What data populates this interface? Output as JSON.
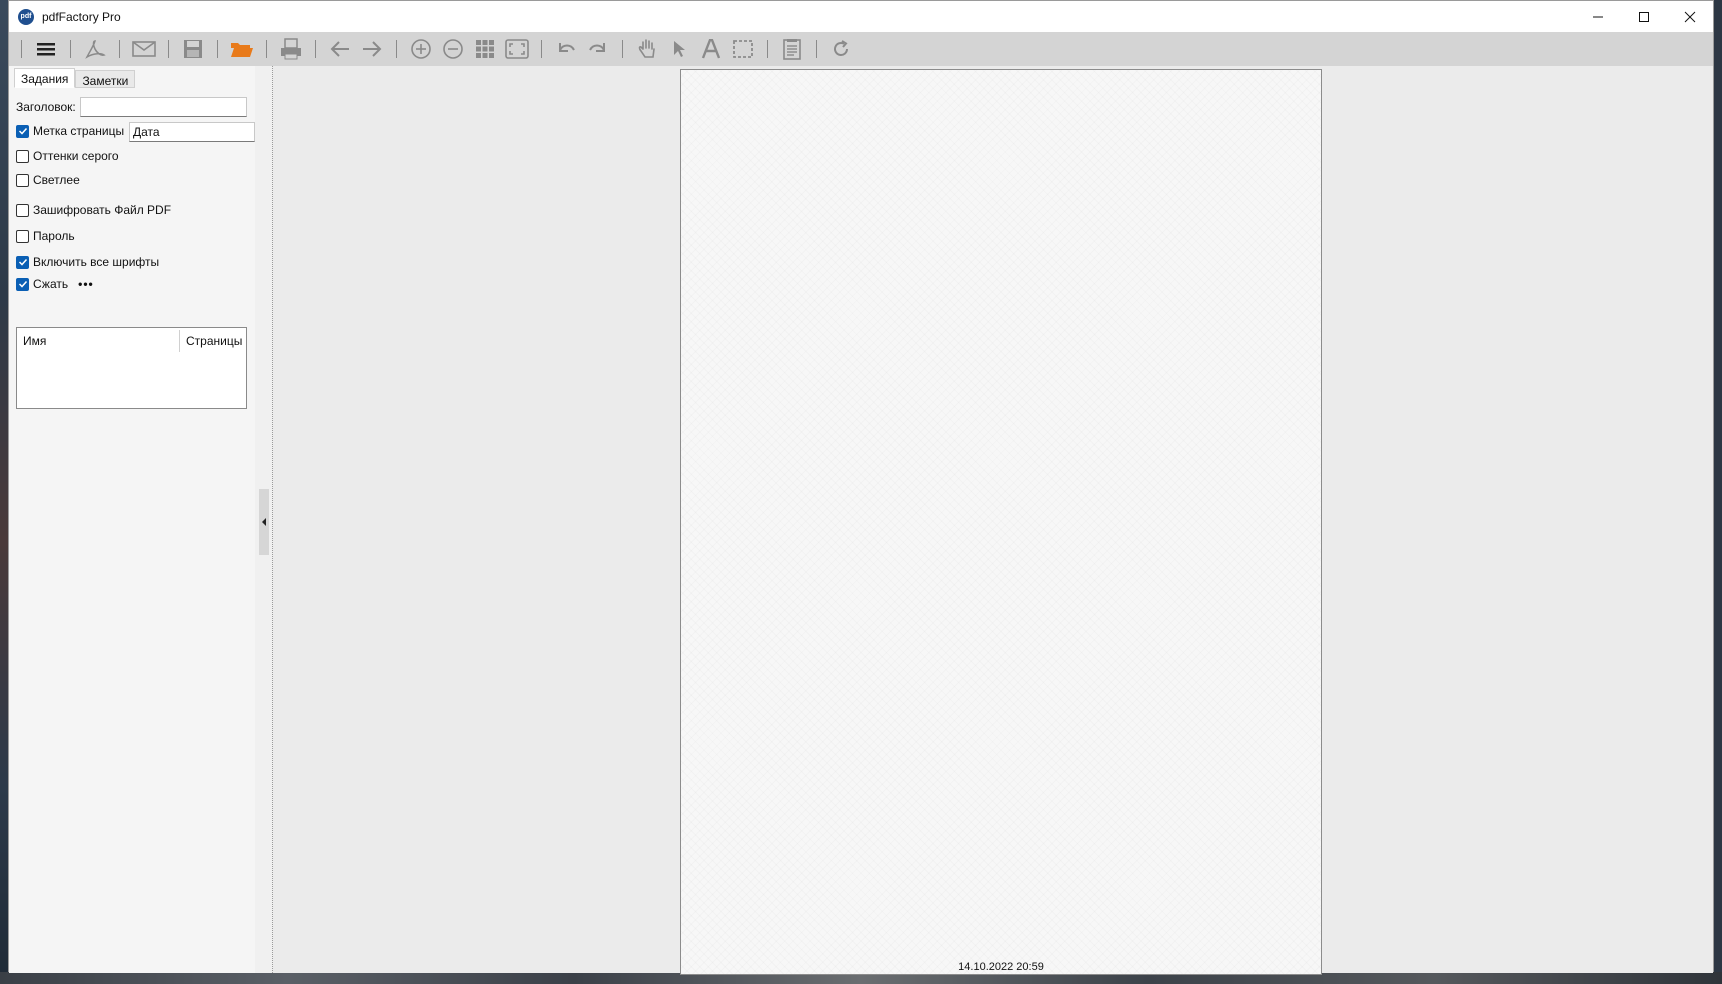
{
  "window": {
    "title": "pdfFactory Pro",
    "app_icon_text": "pdf"
  },
  "toolbar": {
    "buttons": [
      {
        "name": "menu-icon"
      },
      {
        "name": "acrobat-icon"
      },
      {
        "name": "email-icon"
      },
      {
        "name": "save-icon"
      },
      {
        "name": "open-folder-icon"
      },
      {
        "name": "print-icon"
      },
      {
        "name": "back-arrow-icon"
      },
      {
        "name": "forward-arrow-icon"
      },
      {
        "name": "zoom-in-icon"
      },
      {
        "name": "zoom-out-icon"
      },
      {
        "name": "grid-view-icon"
      },
      {
        "name": "fit-page-icon"
      },
      {
        "name": "undo-icon"
      },
      {
        "name": "redo-icon"
      },
      {
        "name": "hand-tool-icon"
      },
      {
        "name": "pointer-tool-icon"
      },
      {
        "name": "text-tool-icon"
      },
      {
        "name": "select-area-icon"
      },
      {
        "name": "document-icon"
      },
      {
        "name": "refresh-icon"
      }
    ],
    "accent_orange": "#e87a1a",
    "icon_gray": "#8a8a8a"
  },
  "left_panel": {
    "tabs": [
      {
        "label": "Задания",
        "active": true
      },
      {
        "label": "Заметки",
        "active": false
      }
    ],
    "title_label": "Заголовок:",
    "title_value": "",
    "page_stamp_label": "Метка страницы",
    "page_stamp_checked": true,
    "page_stamp_value": "Дата",
    "grayscale_label": "Оттенки серого",
    "grayscale_checked": false,
    "lighter_label": "Светлее",
    "lighter_checked": false,
    "encrypt_label": "Зашифровать Файл PDF",
    "encrypt_checked": false,
    "password_label": "Пароль",
    "password_checked": false,
    "embed_fonts_label": "Включить все шрифты",
    "embed_fonts_checked": true,
    "compress_label": "Сжать",
    "compress_checked": true,
    "compress_more": "•••",
    "table": {
      "columns": [
        "Имя",
        "Страницы"
      ],
      "rows": []
    }
  },
  "preview": {
    "page_stamp_text": "14.10.2022 20:59"
  },
  "colors": {
    "checkbox_checked": "#0a5fb4",
    "toolbar_bg": "#d4d4d4",
    "panel_bg": "#f5f5f5",
    "preview_bg": "#ebebeb"
  }
}
